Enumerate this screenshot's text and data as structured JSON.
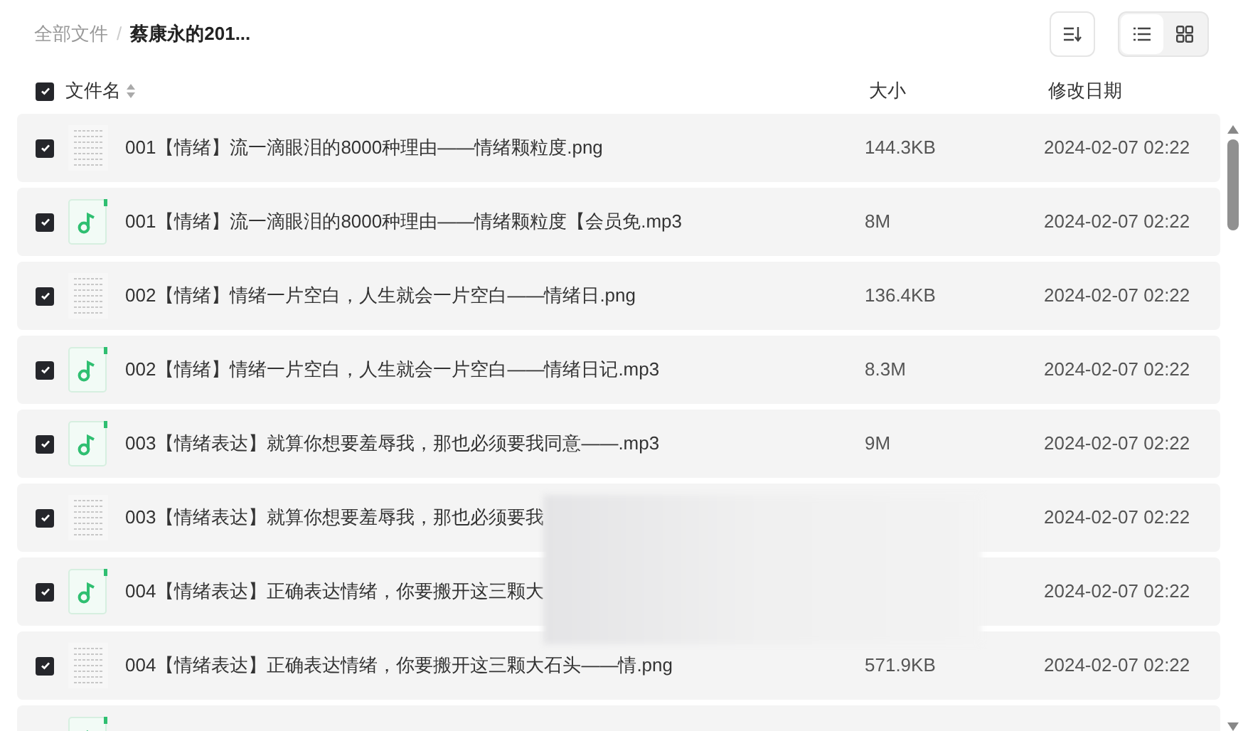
{
  "breadcrumb": [
    {
      "label": "全部文件",
      "current": false
    },
    {
      "label": "蔡康永的201...",
      "current": true
    }
  ],
  "breadcrumb_separator": "/",
  "toolbar": {
    "view_modes": [
      {
        "kind": "list",
        "selected": true
      },
      {
        "kind": "grid",
        "selected": false
      }
    ]
  },
  "table": {
    "select_all": {
      "checked": true
    },
    "columns": [
      {
        "label": "文件名",
        "sortable": true
      },
      {
        "label": "大小",
        "sortable": false
      },
      {
        "label": "修改日期",
        "sortable": false
      }
    ],
    "rows": [
      {
        "kind": "image",
        "checked": true,
        "name": "001【情绪】流一滴眼泪的8000种理由——情绪颗粒度.png",
        "size": "144.3KB",
        "date": "2024-02-07 02:22"
      },
      {
        "kind": "audio",
        "checked": true,
        "name": "001【情绪】流一滴眼泪的8000种理由——情绪颗粒度【会员免.mp3",
        "size": "8M",
        "date": "2024-02-07 02:22"
      },
      {
        "kind": "image",
        "checked": true,
        "name": "002【情绪】情绪一片空白，人生就会一片空白——情绪日.png",
        "size": "136.4KB",
        "date": "2024-02-07 02:22"
      },
      {
        "kind": "audio",
        "checked": true,
        "name": "002【情绪】情绪一片空白，人生就会一片空白——情绪日记.mp3",
        "size": "8.3M",
        "date": "2024-02-07 02:22"
      },
      {
        "kind": "audio",
        "checked": true,
        "name": "003【情绪表达】就算你想要羞辱我，那也必须要我同意——.mp3",
        "size": "9M",
        "date": "2024-02-07 02:22"
      },
      {
        "kind": "image",
        "checked": true,
        "name": "003【情绪表达】就算你想要羞辱我，那也必须要我",
        "date": "2024-02-07 02:22"
      },
      {
        "kind": "audio",
        "checked": true,
        "name": "004【情绪表达】正确表达情绪，你要搬开这三颗大",
        "date": "2024-02-07 02:22"
      },
      {
        "kind": "image",
        "checked": true,
        "name": "004【情绪表达】正确表达情绪，你要搬开这三颗大石头——情.png",
        "size": "571.9KB",
        "date": "2024-02-07 02:22"
      },
      {
        "kind": "audio"
      }
    ]
  }
}
